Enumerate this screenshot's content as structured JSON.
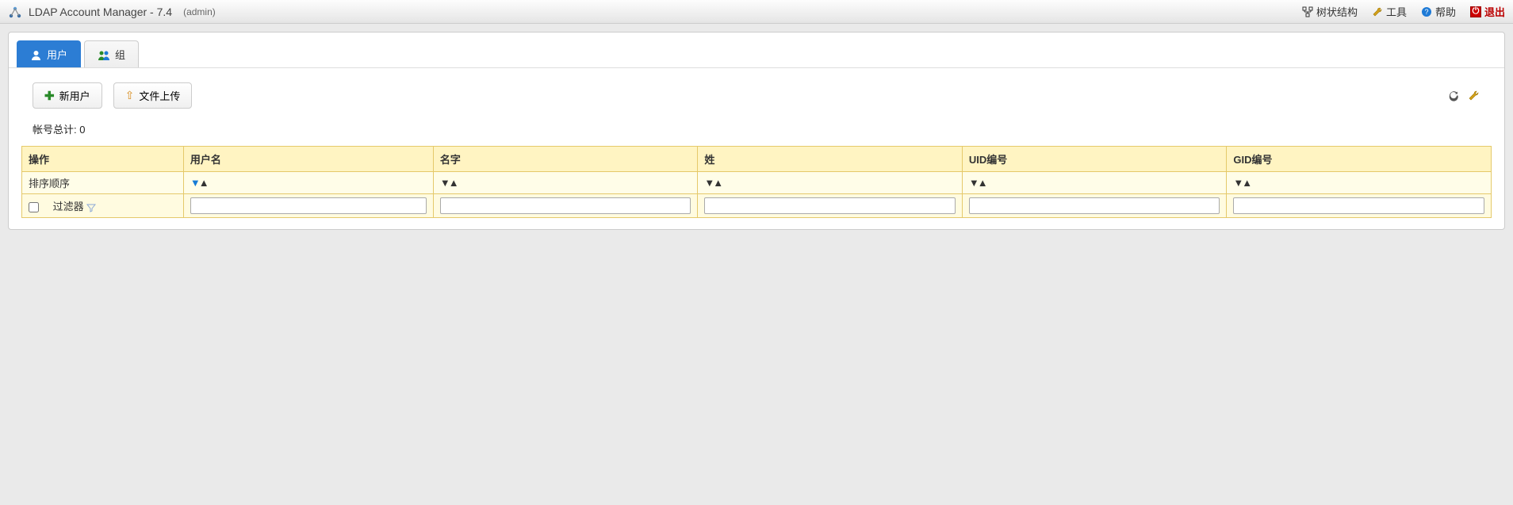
{
  "header": {
    "app_title": "LDAP Account Manager - 7.4",
    "admin": "(admin)"
  },
  "topnav": {
    "tree": "树状结构",
    "tools": "工具",
    "help": "帮助",
    "logout": "退出"
  },
  "tabs": {
    "users": "用户",
    "groups": "组"
  },
  "actions": {
    "new_user": "新用户",
    "file_upload": "文件上传"
  },
  "count": {
    "label": "帐号总计:",
    "value": "0"
  },
  "table": {
    "columns": {
      "action": "操作",
      "username": "用户名",
      "firstname": "名字",
      "lastname": "姓",
      "uid": "UID编号",
      "gid": "GID编号"
    },
    "sort_label": "排序顺序",
    "filter_label": "过滤器"
  }
}
